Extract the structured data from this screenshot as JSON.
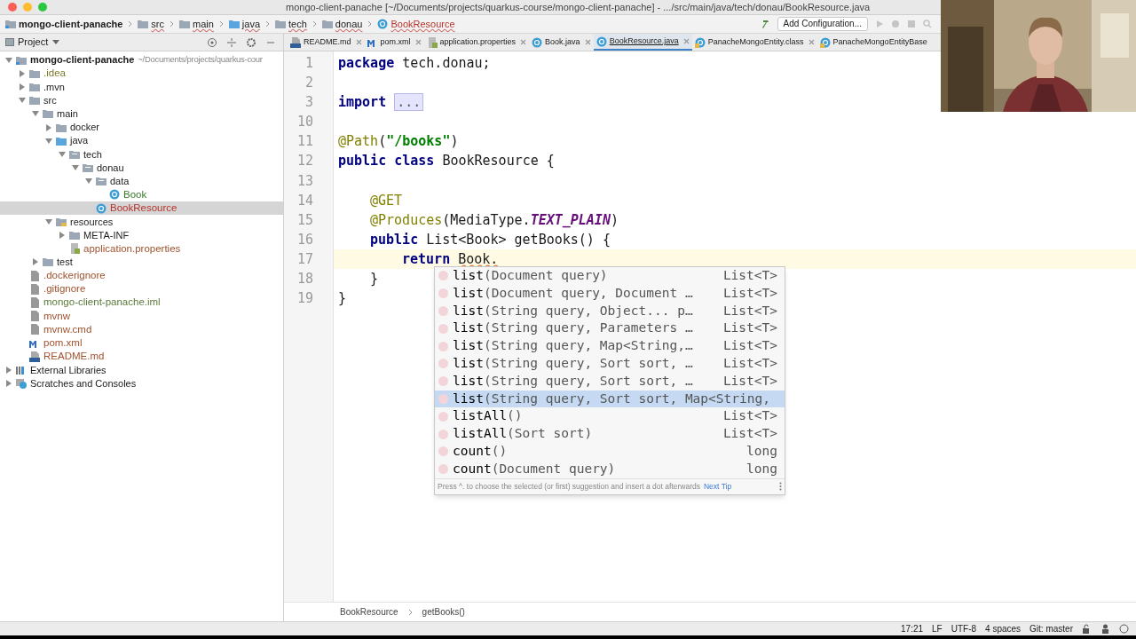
{
  "window": {
    "title": "mongo-client-panache [~/Documents/projects/quarkus-course/mongo-client-panache] - .../src/main/java/tech/donau/BookResource.java"
  },
  "navbar": {
    "crumbs": [
      {
        "label": "mongo-client-panache",
        "kind": "project"
      },
      {
        "label": "src",
        "kind": "folder"
      },
      {
        "label": "main",
        "kind": "folder"
      },
      {
        "label": "java",
        "kind": "source"
      },
      {
        "label": "tech",
        "kind": "folder"
      },
      {
        "label": "donau",
        "kind": "folder"
      },
      {
        "label": "BookResource",
        "kind": "class"
      }
    ],
    "run_config": "Add Configuration..."
  },
  "project_panel": {
    "title": "Project",
    "tree": [
      {
        "label": "mongo-client-panache",
        "hint": "~/Documents/projects/quarkus-cour",
        "kind": "module",
        "expanded": true,
        "children": [
          {
            "label": ".idea",
            "kind": "folder",
            "expanded": false,
            "color": "#7a7a2a"
          },
          {
            "label": ".mvn",
            "kind": "folder",
            "expanded": false
          },
          {
            "label": "src",
            "kind": "folder",
            "expanded": true,
            "children": [
              {
                "label": "main",
                "kind": "folder",
                "expanded": true,
                "children": [
                  {
                    "label": "docker",
                    "kind": "folder",
                    "expanded": false
                  },
                  {
                    "label": "java",
                    "kind": "source",
                    "expanded": true,
                    "children": [
                      {
                        "label": "tech",
                        "kind": "package",
                        "expanded": true,
                        "children": [
                          {
                            "label": "donau",
                            "kind": "package",
                            "expanded": true,
                            "children": [
                              {
                                "label": "data",
                                "kind": "package",
                                "expanded": true,
                                "children": [
                                  {
                                    "label": "Book",
                                    "kind": "class",
                                    "color": "#3a7a2a",
                                    "selected": false
                                  }
                                ]
                              },
                              {
                                "label": "BookResource",
                                "kind": "class",
                                "color": "#b5332a",
                                "selected": true
                              }
                            ]
                          }
                        ]
                      }
                    ]
                  },
                  {
                    "label": "resources",
                    "kind": "resources",
                    "expanded": true,
                    "children": [
                      {
                        "label": "META-INF",
                        "kind": "folder",
                        "expanded": false
                      },
                      {
                        "label": "application.properties",
                        "kind": "properties",
                        "color": "#a0522d",
                        "selected": false
                      }
                    ]
                  }
                ]
              },
              {
                "label": "test",
                "kind": "folder",
                "expanded": false
              }
            ]
          },
          {
            "label": ".dockerignore",
            "kind": "file",
            "color": "#a0522d",
            "selected": false
          },
          {
            "label": ".gitignore",
            "kind": "file",
            "color": "#a0522d",
            "selected": false
          },
          {
            "label": "mongo-client-panache.iml",
            "kind": "file",
            "color": "#5a7a3a",
            "selected": false
          },
          {
            "label": "mvnw",
            "kind": "file",
            "color": "#a0522d",
            "selected": false
          },
          {
            "label": "mvnw.cmd",
            "kind": "file",
            "color": "#a0522d",
            "selected": false
          },
          {
            "label": "pom.xml",
            "kind": "maven",
            "color": "#a0522d",
            "selected": false
          },
          {
            "label": "README.md",
            "kind": "markdown",
            "color": "#a0522d",
            "selected": false
          }
        ]
      },
      {
        "label": "External Libraries",
        "kind": "library",
        "expanded": false
      },
      {
        "label": "Scratches and Consoles",
        "kind": "scratch",
        "expanded": false
      }
    ]
  },
  "tabs": [
    {
      "label": "README.md",
      "kind": "markdown",
      "selected": false
    },
    {
      "label": "pom.xml",
      "kind": "maven",
      "selected": false
    },
    {
      "label": "application.properties",
      "kind": "properties",
      "selected": false
    },
    {
      "label": "Book.java",
      "kind": "class",
      "selected": false
    },
    {
      "label": "BookResource.java",
      "kind": "class",
      "selected": true
    },
    {
      "label": "PanacheMongoEntity.class",
      "kind": "compiled",
      "selected": false
    },
    {
      "label": "PanacheMongoEntityBase",
      "kind": "compiled",
      "selected": false
    }
  ],
  "editor": {
    "lines": [
      {
        "number": "1",
        "current": false,
        "tokens": [
          {
            "kind": "keyword",
            "text": "package "
          },
          {
            "kind": "plain",
            "text": "tech.donau;"
          }
        ]
      },
      {
        "number": "2",
        "current": false
      },
      {
        "number": "3",
        "current": false,
        "tokens": [
          {
            "kind": "keyword",
            "text": "import "
          },
          {
            "kind": "folded",
            "text": "..."
          }
        ]
      },
      {
        "number": "10",
        "current": false
      },
      {
        "number": "11",
        "current": false,
        "tokens": [
          {
            "kind": "annotation",
            "text": "@Path"
          },
          {
            "kind": "plain",
            "text": "("
          },
          {
            "kind": "string",
            "text": "\"/books\""
          },
          {
            "kind": "plain",
            "text": ")"
          }
        ]
      },
      {
        "number": "12",
        "current": false,
        "tokens": [
          {
            "kind": "keyword",
            "text": "public class "
          },
          {
            "kind": "plain",
            "text": "BookResource {"
          }
        ]
      },
      {
        "number": "13",
        "current": false
      },
      {
        "number": "14",
        "current": false,
        "kind": "member",
        "tokens": [
          {
            "kind": "annotation",
            "text": "@GET"
          }
        ]
      },
      {
        "number": "15",
        "current": false,
        "kind": "member",
        "tokens": [
          {
            "kind": "annotation",
            "text": "@Produces"
          },
          {
            "kind": "plain",
            "text": "(MediaType."
          },
          {
            "kind": "constant",
            "text": "TEXT_PLAIN"
          },
          {
            "kind": "plain",
            "text": ")"
          }
        ]
      },
      {
        "number": "16",
        "current": false,
        "kind": "member",
        "tokens": [
          {
            "kind": "keyword",
            "text": "public "
          },
          {
            "kind": "plain",
            "text": "List<Book> getBooks() {"
          }
        ]
      },
      {
        "number": "17",
        "current": true,
        "kind": "statement",
        "tokens": [
          {
            "kind": "keyword",
            "text": "return "
          },
          {
            "kind": "error",
            "text": "Book."
          }
        ]
      },
      {
        "number": "18",
        "current": false,
        "kind": "member",
        "tokens": [
          {
            "kind": "plain",
            "text": "}"
          }
        ]
      },
      {
        "number": "19",
        "current": false,
        "tokens": [
          {
            "kind": "plain",
            "text": "}"
          }
        ]
      }
    ],
    "completion": {
      "items": [
        {
          "name": "list",
          "params": "(Document query)",
          "type": "List<T>",
          "selected": false
        },
        {
          "name": "list",
          "params": "(Document query, Document …",
          "type": "List<T>",
          "selected": false
        },
        {
          "name": "list",
          "params": "(String query, Object... p…",
          "type": "List<T>",
          "selected": false
        },
        {
          "name": "list",
          "params": "(String query, Parameters …",
          "type": "List<T>",
          "selected": false
        },
        {
          "name": "list",
          "params": "(String query, Map<String,…",
          "type": "List<T>",
          "selected": false
        },
        {
          "name": "list",
          "params": "(String query, Sort sort, …",
          "type": "List<T>",
          "selected": false
        },
        {
          "name": "list",
          "params": "(String query, Sort sort, …",
          "type": "List<T>",
          "selected": false
        },
        {
          "name": "list",
          "params": "(String query, Sort sort, Map<String,",
          "selected": true
        },
        {
          "name": "listAll",
          "params": "()",
          "type": "List<T>",
          "selected": false
        },
        {
          "name": "listAll",
          "params": "(Sort sort)",
          "type": "List<T>",
          "selected": false
        },
        {
          "name": "count",
          "params": "()",
          "type": "long",
          "selected": false
        },
        {
          "name": "count",
          "params": "(Document query)",
          "type": "long",
          "selected": false
        }
      ],
      "hint": "Press ^. to choose the selected (or first) suggestion and insert a dot afterwards",
      "tip_link": "Next Tip"
    },
    "breadcrumbs": [
      "BookResource",
      "getBooks()"
    ]
  },
  "status_bar": {
    "items": [
      "17:21",
      "LF",
      "UTF-8",
      "4 spaces",
      "Git: master"
    ]
  }
}
